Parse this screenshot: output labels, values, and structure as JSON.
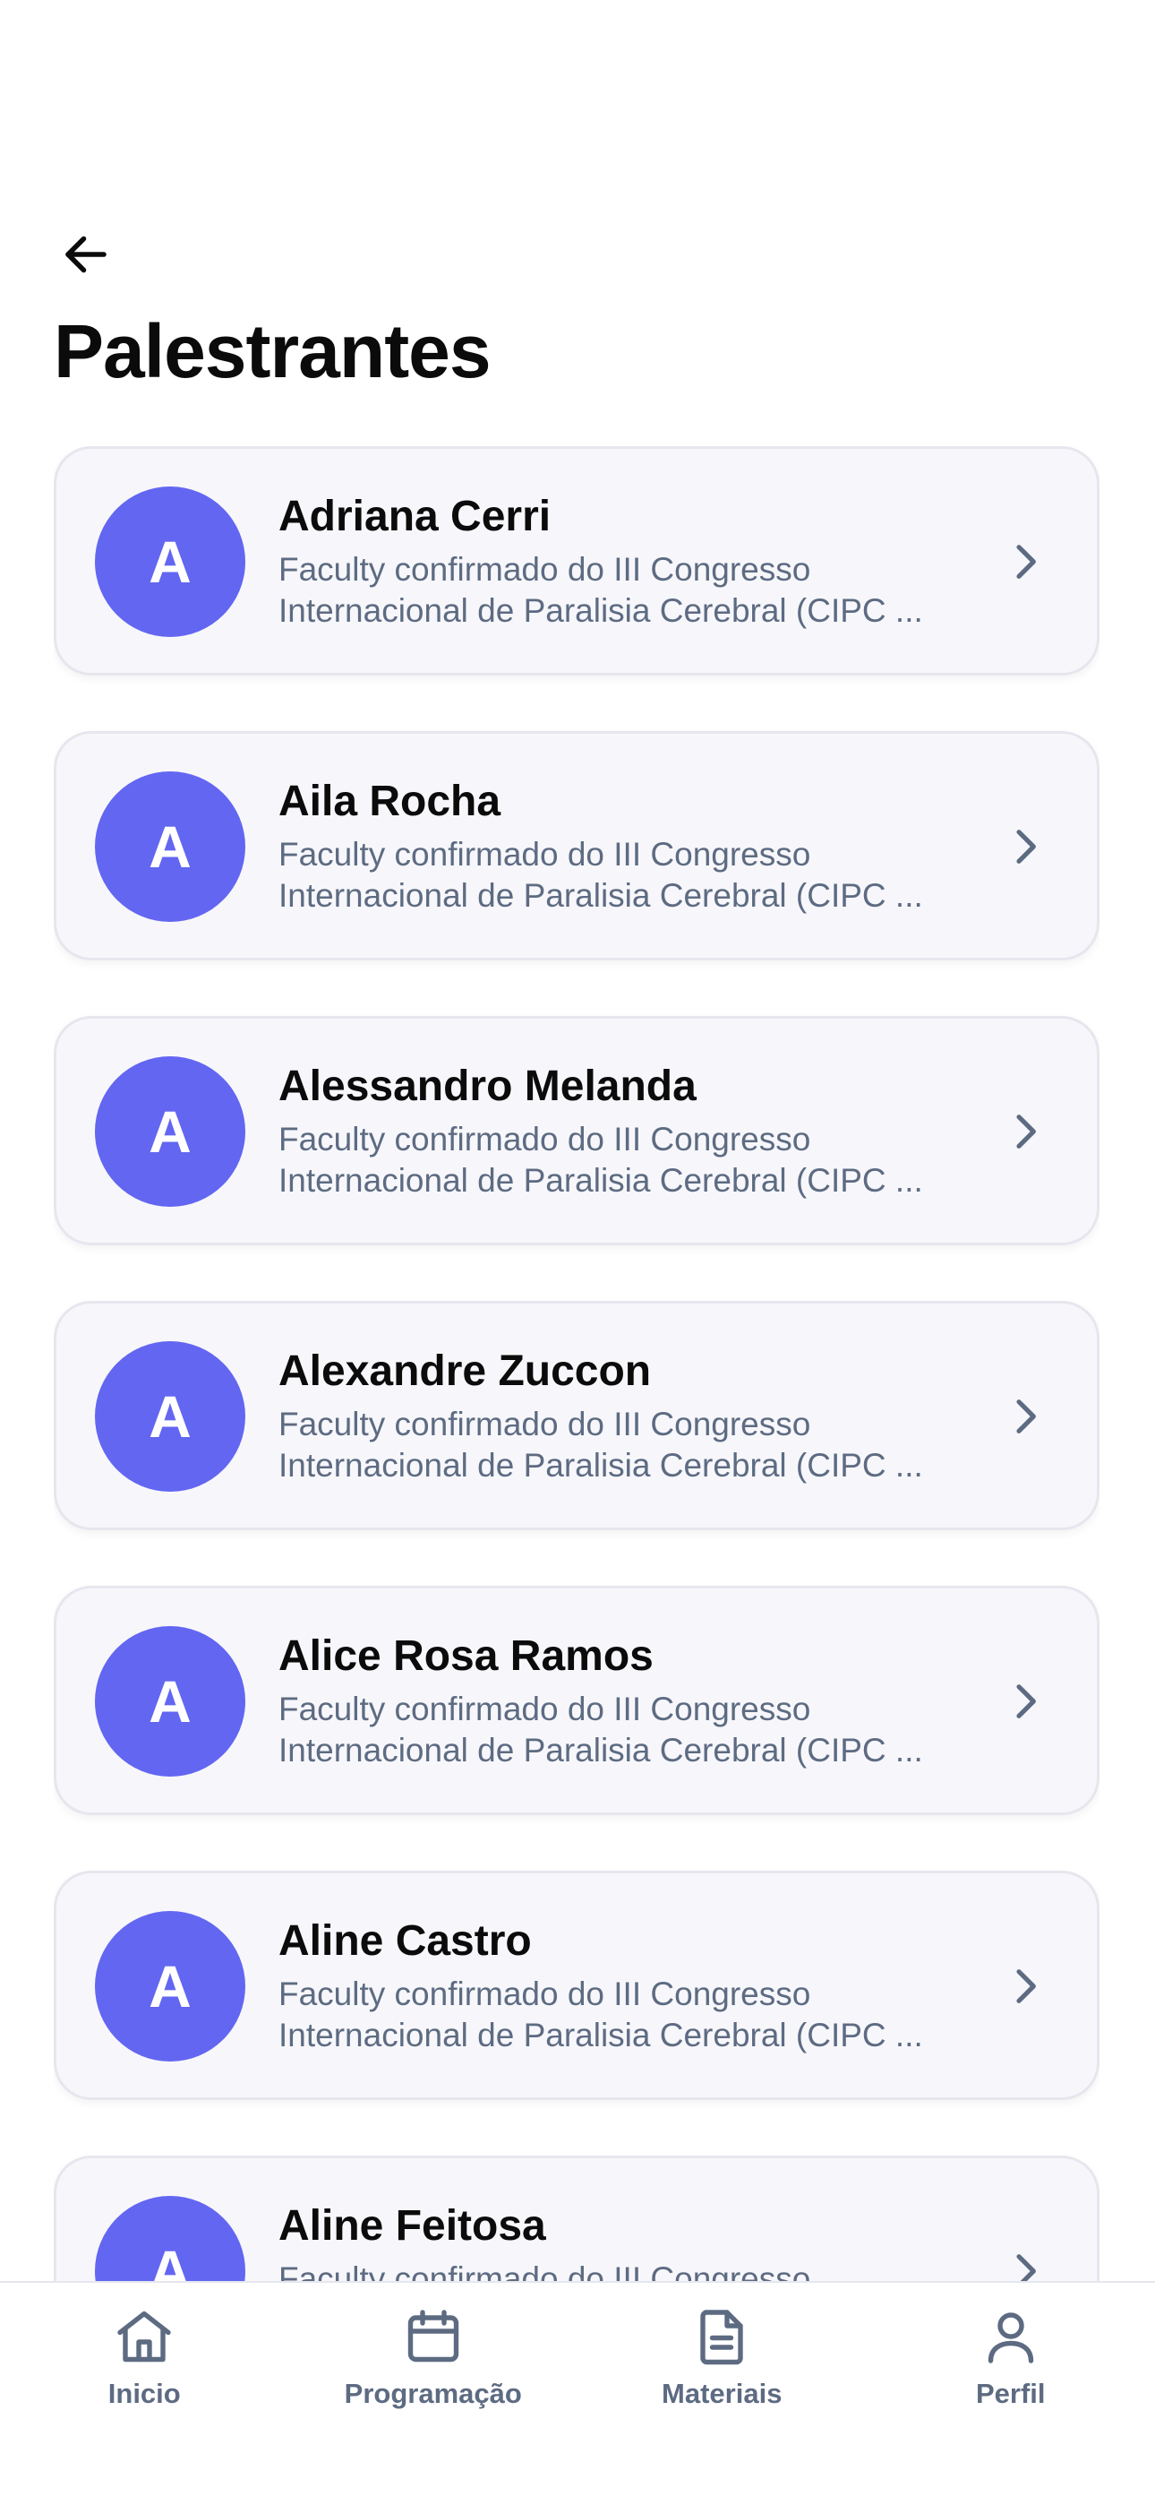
{
  "page": {
    "title": "Palestrantes"
  },
  "speakers": [
    {
      "initial": "A",
      "name": "Adriana Cerri",
      "description": "Faculty confirmado do III Congresso Internacional de Paralisia Cerebral (CIPC ..."
    },
    {
      "initial": "A",
      "name": "Aila Rocha",
      "description": "Faculty confirmado do III Congresso Internacional de Paralisia Cerebral (CIPC ..."
    },
    {
      "initial": "A",
      "name": "Alessandro Melanda",
      "description": "Faculty confirmado do III Congresso Internacional de Paralisia Cerebral (CIPC ..."
    },
    {
      "initial": "A",
      "name": "Alexandre Zuccon",
      "description": "Faculty confirmado do III Congresso Internacional de Paralisia Cerebral (CIPC ..."
    },
    {
      "initial": "A",
      "name": "Alice Rosa Ramos",
      "description": "Faculty confirmado do III Congresso Internacional de Paralisia Cerebral (CIPC ..."
    },
    {
      "initial": "A",
      "name": "Aline Castro",
      "description": "Faculty confirmado do III Congresso Internacional de Paralisia Cerebral (CIPC ..."
    },
    {
      "initial": "A",
      "name": "Aline Feitosa",
      "description": "Faculty confirmado do III Congresso Internacional de Paralisia Cerebral (CIPC ..."
    }
  ],
  "tabbar": {
    "tabs": [
      {
        "label": "Inicio",
        "icon": "home-icon"
      },
      {
        "label": "Programação",
        "icon": "calendar-icon"
      },
      {
        "label": "Materiais",
        "icon": "document-icon"
      },
      {
        "label": "Perfil",
        "icon": "user-icon"
      }
    ]
  },
  "colors": {
    "accent": "#6366f1",
    "card_background": "#f7f7fb",
    "muted_text": "#5d6b82"
  }
}
